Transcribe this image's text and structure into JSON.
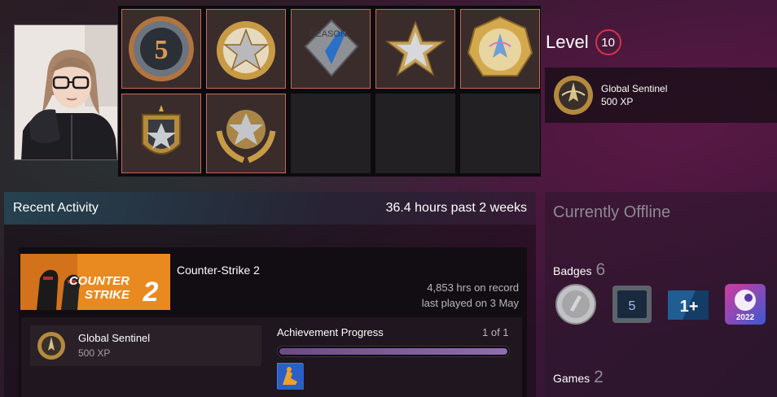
{
  "profile": {
    "avatar_alt": "Profile avatar"
  },
  "showcase": {
    "slots": [
      {
        "icon": "five-year-veteran-coin-icon",
        "filled": true
      },
      {
        "icon": "gold-star-medal-icon",
        "filled": true
      },
      {
        "icon": "season-one-medal-icon",
        "filled": true
      },
      {
        "icon": "silver-star-badge-icon",
        "filled": true
      },
      {
        "icon": "gold-counter-strike-coin-icon",
        "filled": true
      },
      {
        "icon": "star-shield-medal-icon",
        "filled": true
      },
      {
        "icon": "star-laurel-medal-icon",
        "filled": true
      },
      {
        "icon": "empty-slot",
        "filled": false
      },
      {
        "icon": "empty-slot",
        "filled": false
      },
      {
        "icon": "empty-slot",
        "filled": false
      }
    ]
  },
  "level": {
    "label": "Level",
    "value": "10"
  },
  "favorite_badge": {
    "name": "Global Sentinel",
    "xp": "500 XP"
  },
  "recent_activity": {
    "title": "Recent Activity",
    "hours_summary": "36.4 hours past 2 weeks",
    "game": {
      "name": "Counter-Strike 2",
      "capsule_text_line1": "COUNTER",
      "capsule_text_line2": "STRIKE",
      "capsule_number": "2",
      "hours_on_record": "4,853 hrs on record",
      "last_played": "last played on 3 May",
      "achievement": {
        "name": "Global Sentinel",
        "xp": "500 XP"
      },
      "achievement_progress": {
        "label": "Achievement Progress",
        "count": "1 of 1",
        "fraction": 1.0
      }
    }
  },
  "sidebar": {
    "status": "Currently Offline",
    "badges_label": "Badges",
    "badges_count": "6",
    "badges": [
      {
        "icon": "silver-coin-badge-icon"
      },
      {
        "icon": "five-years-badge-icon",
        "text": "5"
      },
      {
        "icon": "one-plus-badge-icon",
        "text": "1+"
      },
      {
        "icon": "steam-2022-badge-icon",
        "text": "2022"
      }
    ],
    "games_label": "Games",
    "games_count": "2"
  },
  "colors": {
    "level_ring": "#d2334b",
    "slot_border": "#c06a5c",
    "capsule_orange": "#e98a20",
    "progress_fill": "#8e6db0"
  }
}
